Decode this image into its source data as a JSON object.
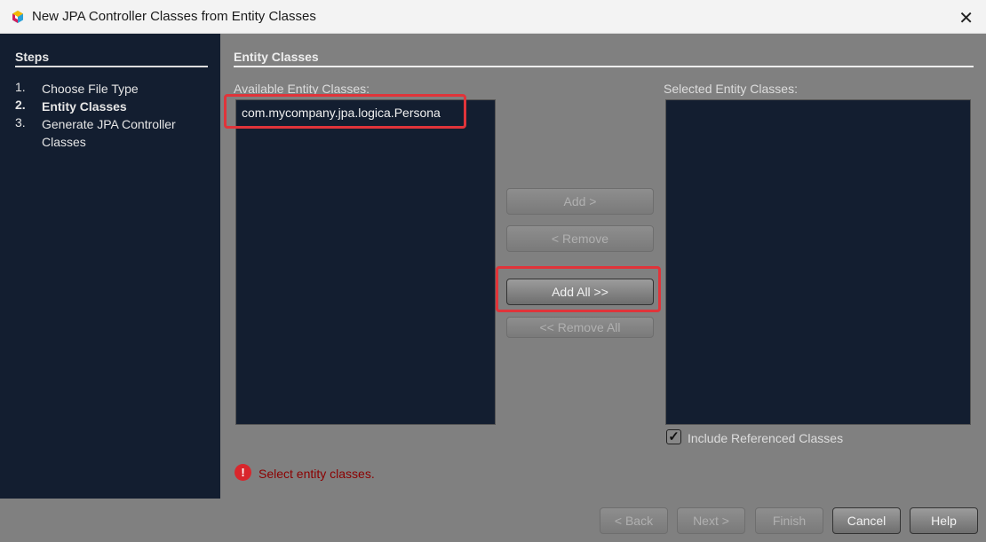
{
  "window": {
    "title": "New JPA Controller Classes from Entity Classes",
    "close_icon": "close-icon"
  },
  "steps": {
    "heading": "Steps",
    "items": [
      {
        "num": "1.",
        "label": "Choose File Type",
        "current": false
      },
      {
        "num": "2.",
        "label": "Entity Classes",
        "current": true
      },
      {
        "num": "3.",
        "label": "Generate JPA Controller Classes",
        "current": false
      }
    ]
  },
  "main": {
    "heading": "Entity Classes",
    "available_label": "Available Entity Classes:",
    "available_items": [
      "com.mycompany.jpa.logica.Persona"
    ],
    "selected_label": "Selected Entity Classes:",
    "buttons": {
      "add": "Add >",
      "remove": "< Remove",
      "add_all": "Add All >>",
      "remove_all": "<< Remove All"
    },
    "include_referenced": {
      "label": "Include Referenced Classes",
      "checked": true
    },
    "error": "Select entity classes."
  },
  "footer": {
    "back": "< Back",
    "next": "Next >",
    "finish": "Finish",
    "cancel": "Cancel",
    "help": "Help"
  },
  "colors": {
    "highlight": "#e0343a",
    "panel": "#131e30",
    "error": "#8b0000"
  }
}
